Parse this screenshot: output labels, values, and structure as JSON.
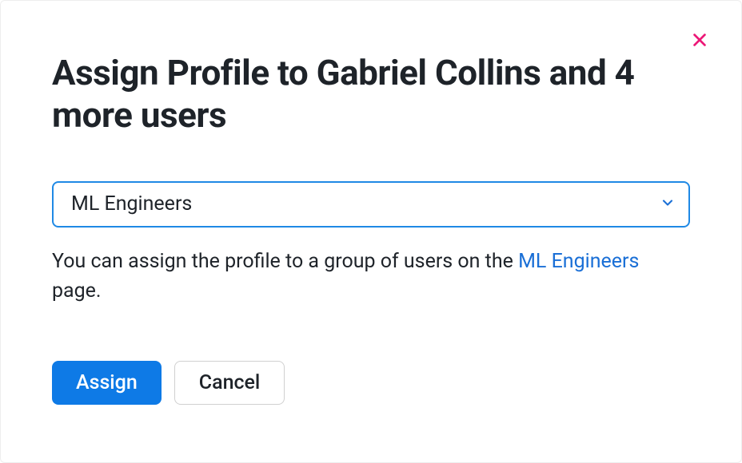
{
  "dialog": {
    "title": "Assign Profile to Gabriel Collins and 4 more users",
    "close_label": "Close"
  },
  "profile_select": {
    "selected": "ML Engineers"
  },
  "helper": {
    "prefix": "You can assign the profile to a group of users on the ",
    "link_text": "ML Engineers",
    "suffix": " page."
  },
  "buttons": {
    "assign": "Assign",
    "cancel": "Cancel"
  }
}
